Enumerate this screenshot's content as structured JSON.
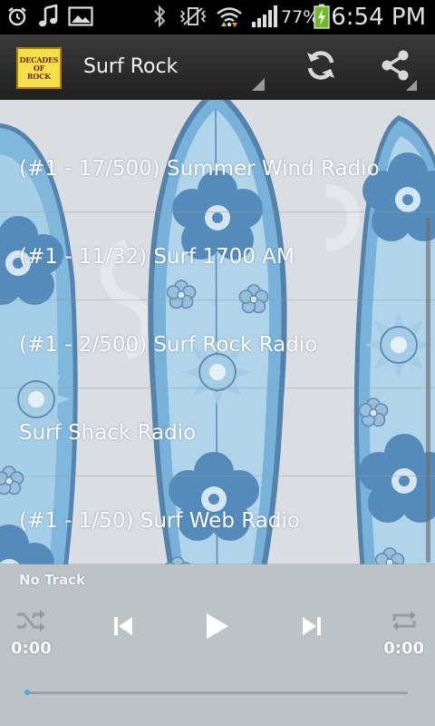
{
  "status_bar": {
    "battery_percent": "77%",
    "time": "6:54 PM",
    "icons": [
      "alarm-clock-icon",
      "music-note-icon",
      "image-icon",
      "bluetooth-icon",
      "vibrate-icon",
      "wifi-icon",
      "signal-icon",
      "battery-charging-icon"
    ]
  },
  "action_bar": {
    "logo_lines": [
      "DECADES",
      "OF",
      "ROCK"
    ],
    "title": "Surf Rock",
    "icons": [
      "refresh-icon",
      "share-icon"
    ]
  },
  "stations": [
    {
      "label": "(#1 - 17/500) Summer Wind Radio"
    },
    {
      "label": "(#1 - 11/32) Surf 1700 AM"
    },
    {
      "label": "(#1 - 2/500) Surf Rock Radio"
    },
    {
      "label": "Surf Shack Radio"
    },
    {
      "label": "(#1 - 1/50) Surf Web Radio"
    }
  ],
  "player": {
    "now_playing": "No Track",
    "elapsed": "0:00",
    "duration": "0:00",
    "progress": 0,
    "icons": [
      "shuffle-icon",
      "previous-icon",
      "play-icon",
      "next-icon",
      "repeat-icon"
    ],
    "accent_color": "#3fb0e6"
  }
}
